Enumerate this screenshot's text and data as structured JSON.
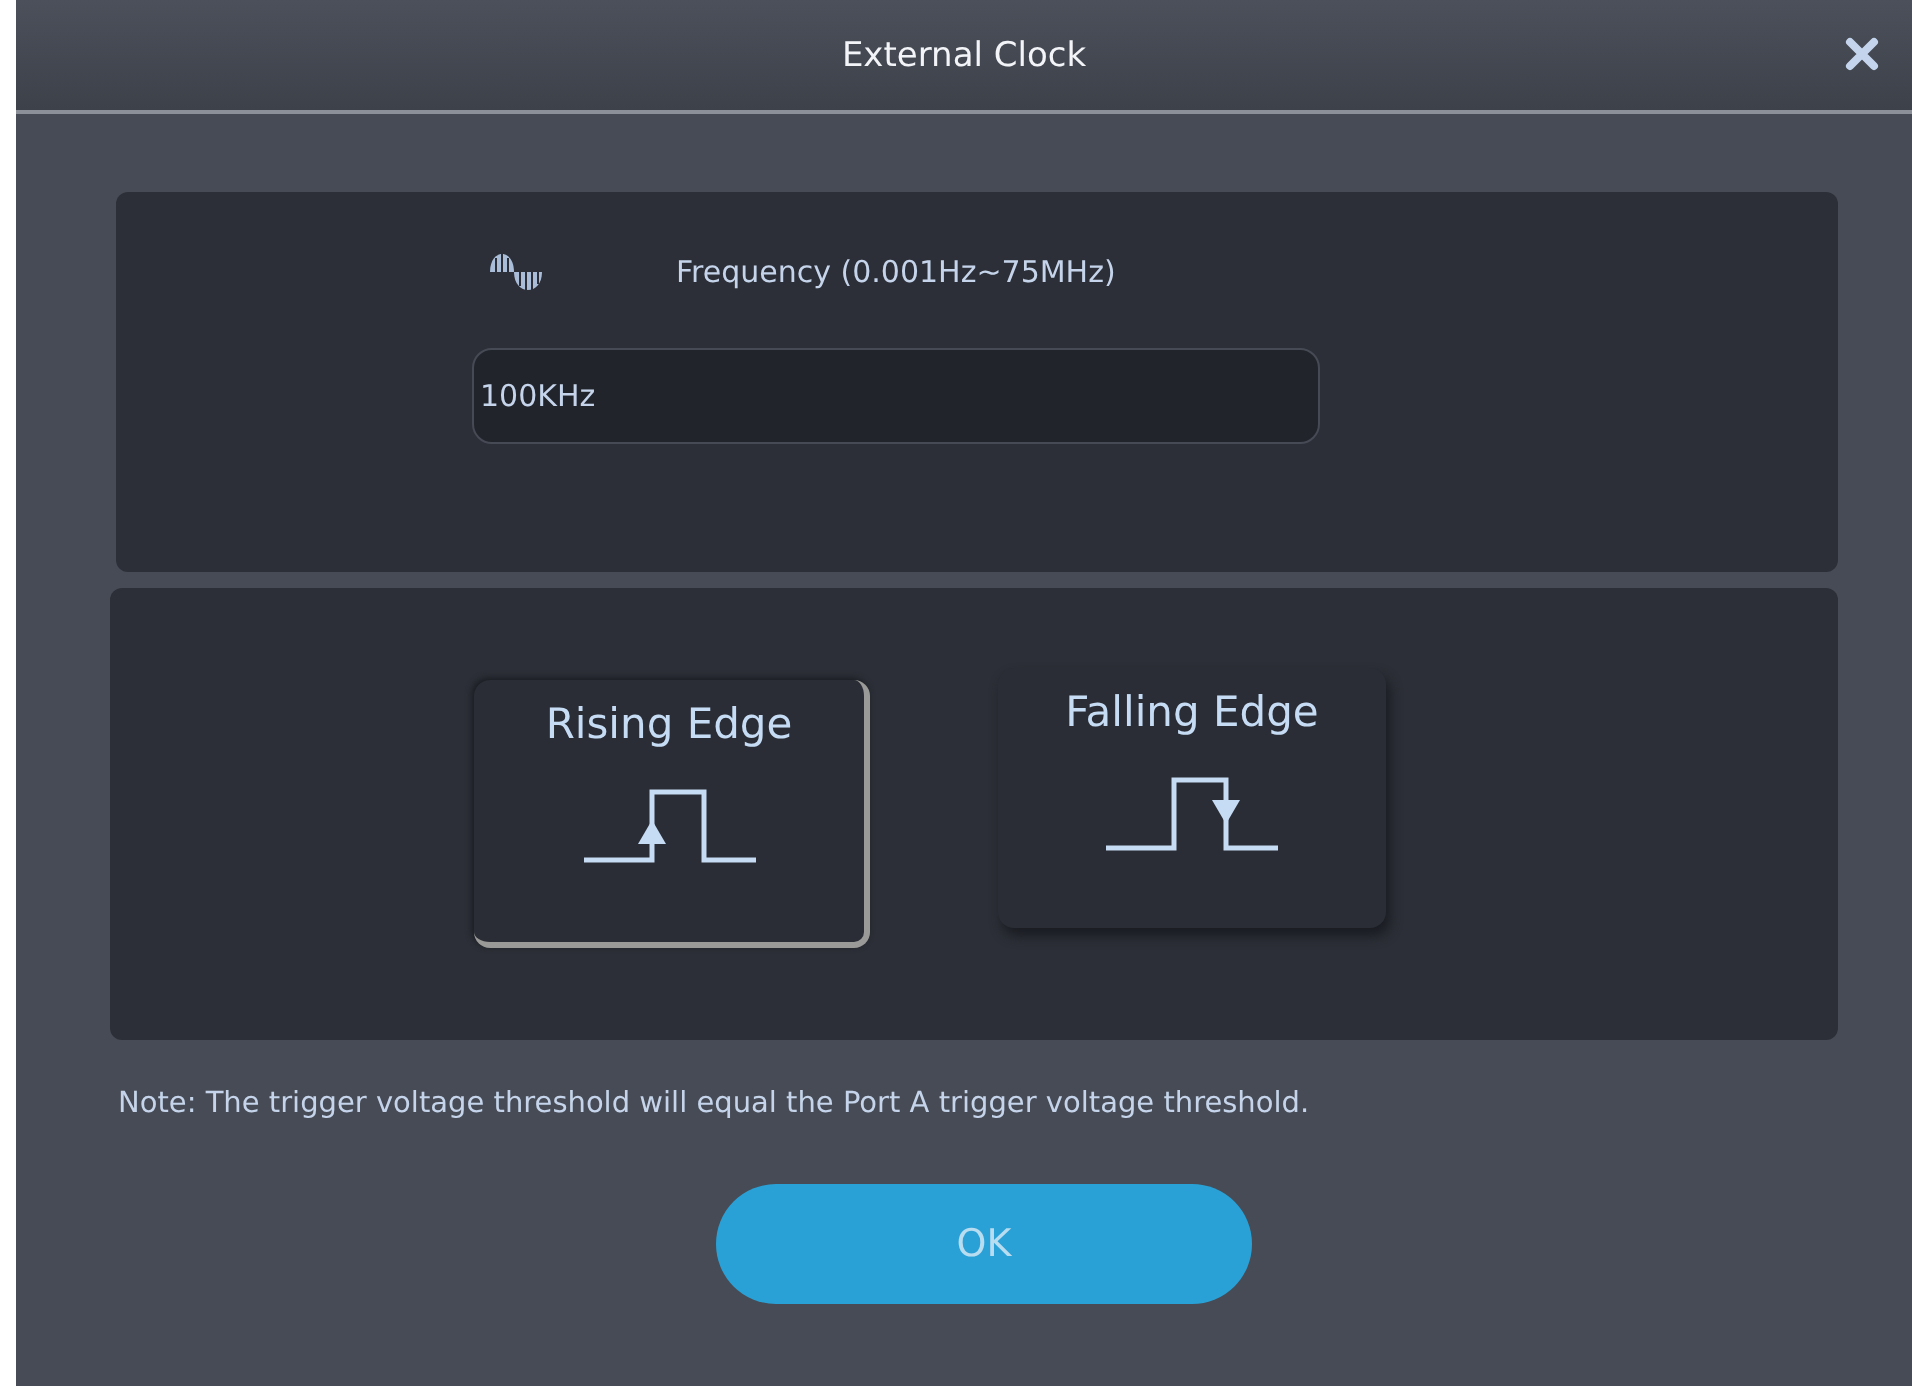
{
  "window": {
    "title": "External Clock"
  },
  "frequency": {
    "label": "Frequency (0.001Hz~75MHz)",
    "value": "100KHz"
  },
  "edges": [
    {
      "kind": "rising",
      "label": "Rising Edge",
      "selected": true
    },
    {
      "kind": "falling",
      "label": "Falling Edge",
      "selected": false
    }
  ],
  "note": "Note: The trigger voltage threshold will equal the Port A trigger voltage threshold.",
  "buttons": [
    "OK"
  ]
}
